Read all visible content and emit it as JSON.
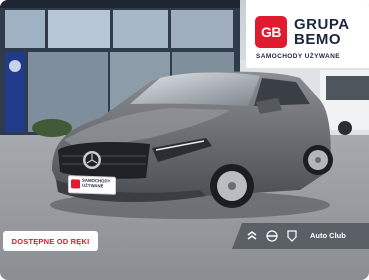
{
  "logo": {
    "badge": "GB",
    "line1": "GRUPA",
    "line2": "BEMO",
    "subtitle": "SAMOCHODY UŻYWANE",
    "brand_color": "#e01b2f",
    "text_color": "#1d2740"
  },
  "badge": {
    "availability": "DOSTĘPNE OD RĘKI"
  },
  "dealer": {
    "name": "Auto Club",
    "icons": [
      "citroen-icon",
      "opel-icon",
      "peugeot-icon"
    ]
  },
  "plate": {
    "line1": "SAMOCHODY",
    "line2": "UŻYWANE"
  }
}
